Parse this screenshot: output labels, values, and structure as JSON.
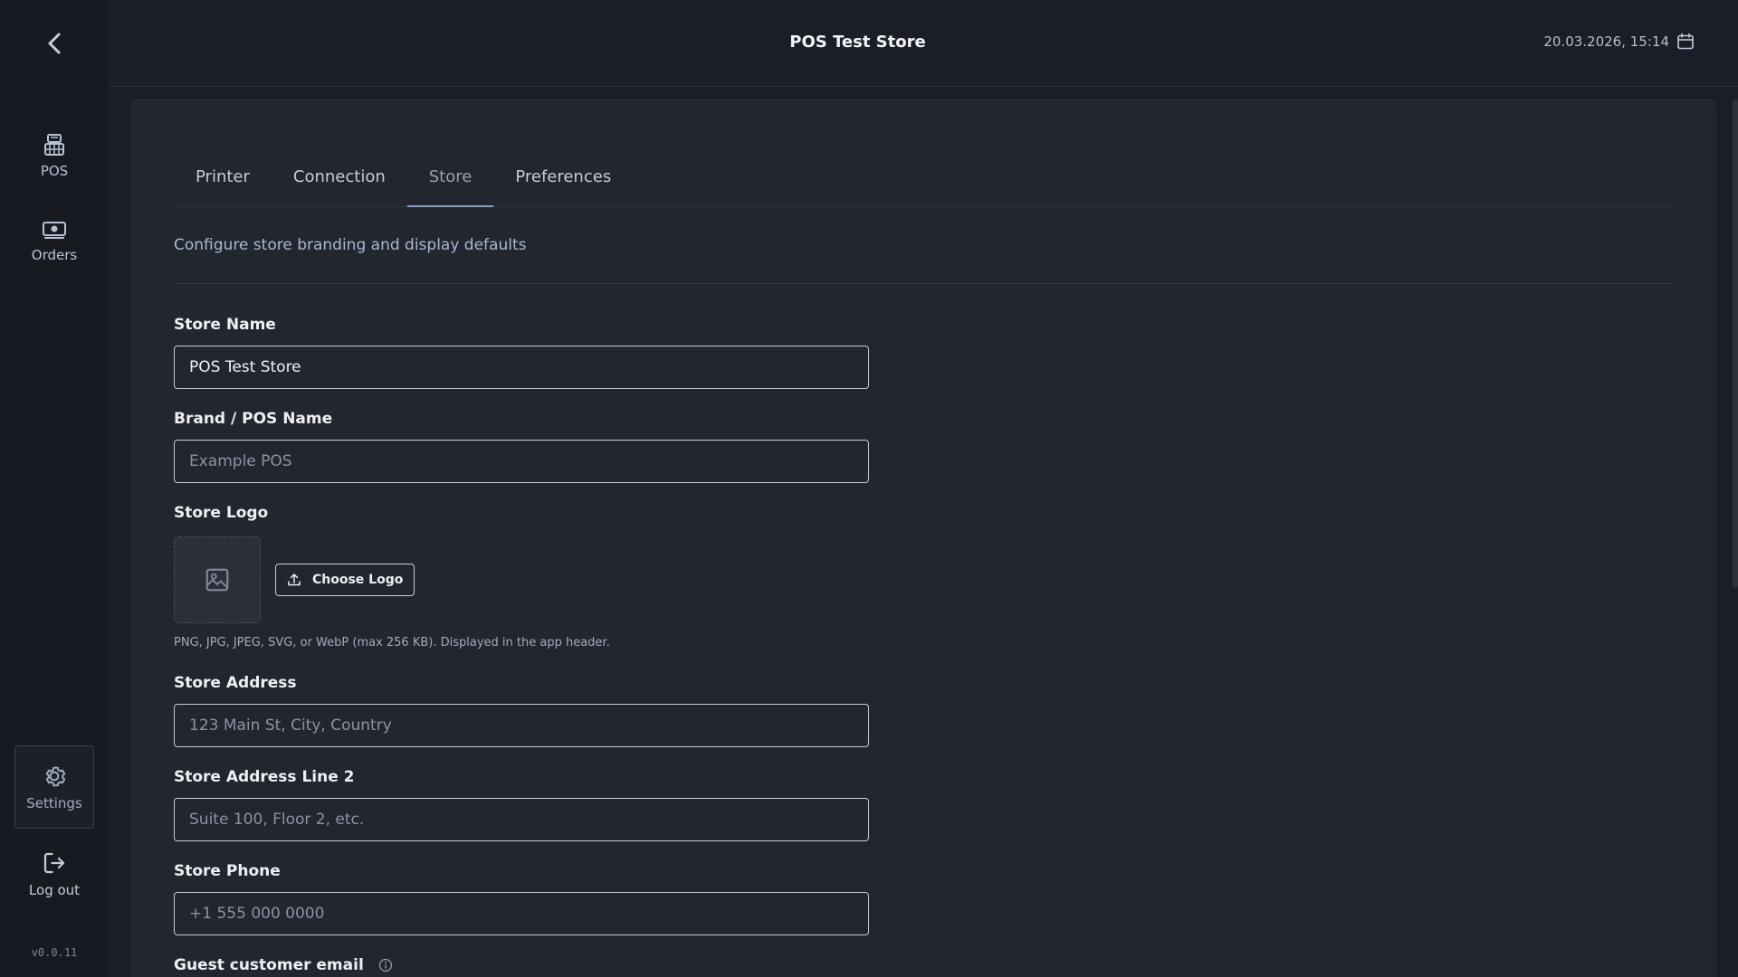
{
  "sidebar": {
    "nav": [
      {
        "label": "POS",
        "icon": "pos-terminal-icon"
      },
      {
        "label": "Orders",
        "icon": "cash-icon"
      }
    ],
    "settings_label": "Settings",
    "logout_label": "Log out",
    "version": "v0.0.11"
  },
  "header": {
    "title": "POS Test Store",
    "datetime": "20.03.2026, 15:14"
  },
  "tabs": [
    {
      "label": "Printer",
      "active": false
    },
    {
      "label": "Connection",
      "active": false
    },
    {
      "label": "Store",
      "active": true
    },
    {
      "label": "Preferences",
      "active": false
    }
  ],
  "store": {
    "subtitle": "Configure store branding and display defaults",
    "store_name": {
      "label": "Store Name",
      "value": "POS Test Store",
      "placeholder": ""
    },
    "brand_name": {
      "label": "Brand / POS Name",
      "value": "",
      "placeholder": "Example POS"
    },
    "logo": {
      "label": "Store Logo",
      "button_label": "Choose Logo",
      "hint": "PNG, JPG, JPEG, SVG, or WebP (max 256 KB). Displayed in the app header."
    },
    "address": {
      "label": "Store Address",
      "value": "",
      "placeholder": "123 Main St, City, Country"
    },
    "address2": {
      "label": "Store Address Line 2",
      "value": "",
      "placeholder": "Suite 100, Floor 2, etc."
    },
    "phone": {
      "label": "Store Phone",
      "value": "",
      "placeholder": "+1 555 000 0000"
    },
    "guest_email": {
      "label": "Guest customer email"
    }
  },
  "colors": {
    "background": "#1b1e26",
    "card": "#22262e",
    "accent": "#8c9fbd"
  }
}
